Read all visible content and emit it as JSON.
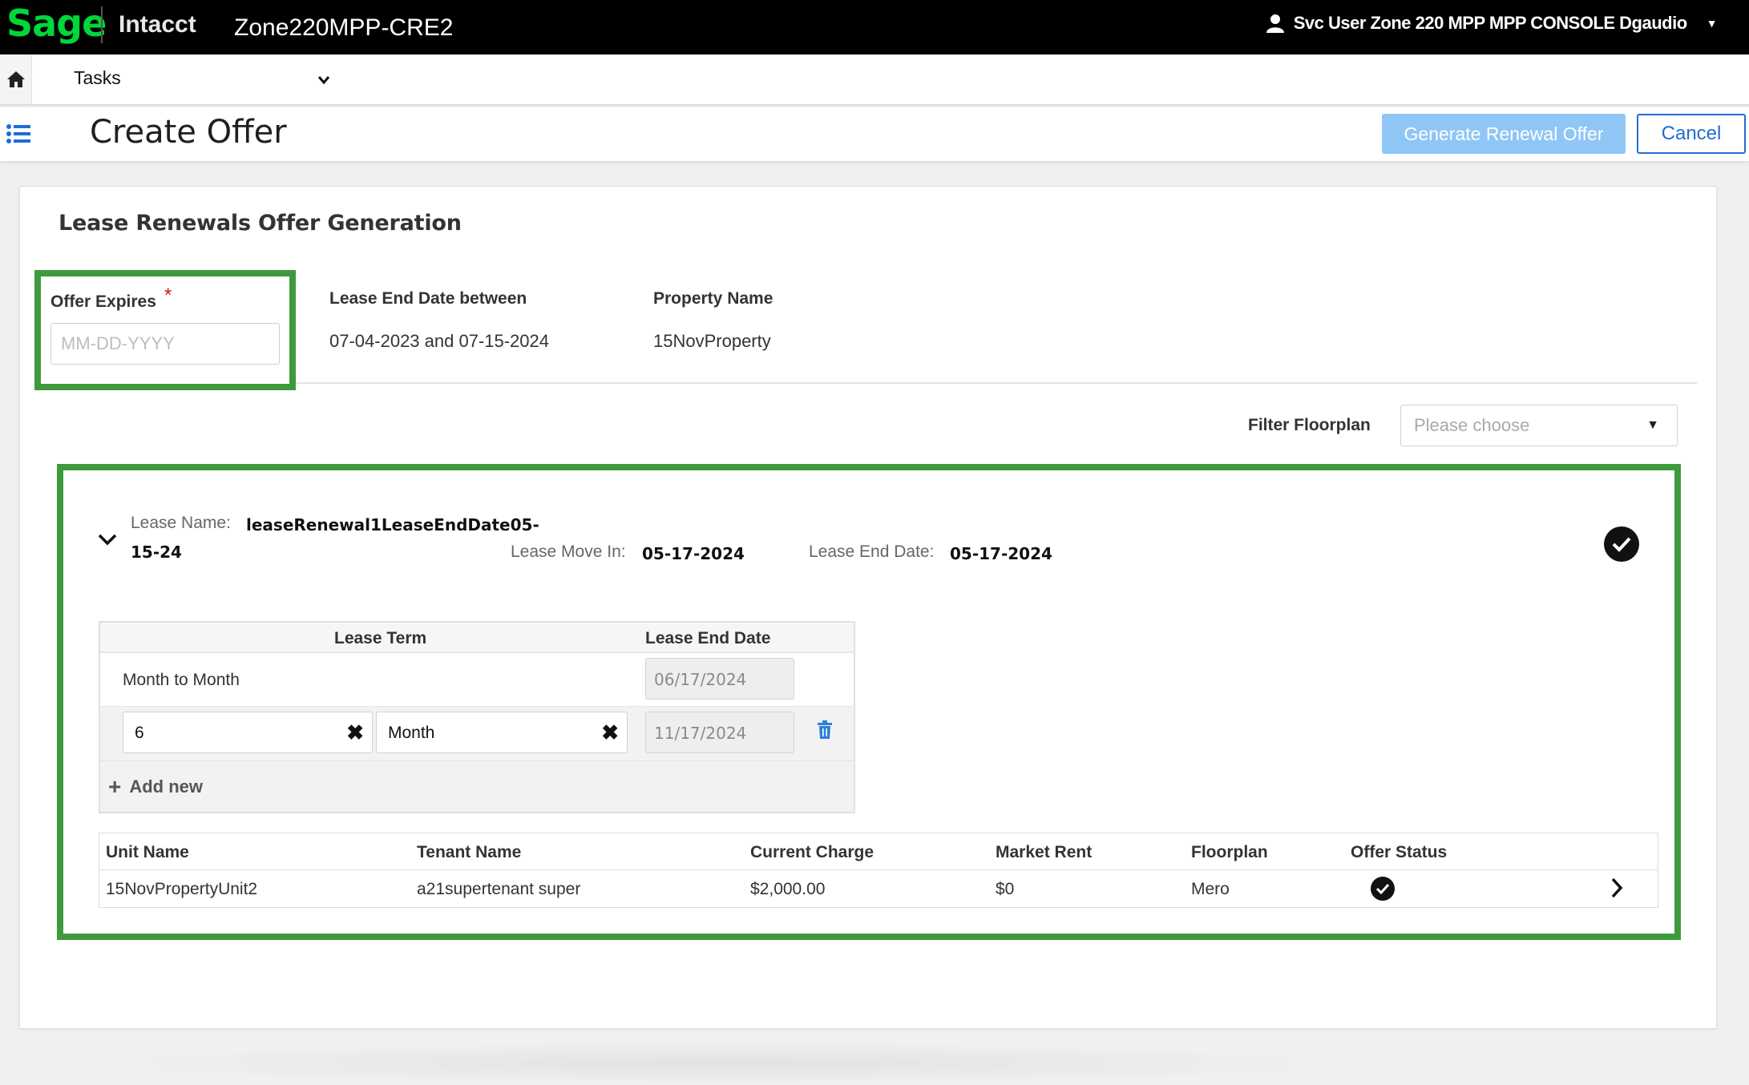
{
  "header": {
    "logo": "Sage",
    "product": "Intacct",
    "company": "Zone220MPP-CRE2",
    "user": "Svc User Zone 220 MPP MPP CONSOLE Dgaudio"
  },
  "nav": {
    "menu": "Tasks"
  },
  "page": {
    "title": "Create Offer",
    "generate_label": "Generate Renewal Offer",
    "cancel_label": "Cancel"
  },
  "form": {
    "section_title": "Lease Renewals Offer Generation",
    "offer_expires_label": "Offer Expires",
    "required_mark": "*",
    "offer_expires_placeholder": "MM-DD-YYYY",
    "offer_expires_value": "",
    "lease_end_label": "Lease End Date between",
    "lease_end_value": "07-04-2023 and 07-15-2024",
    "property_label": "Property Name",
    "property_value": "15NovProperty",
    "filter_label": "Filter Floorplan",
    "filter_placeholder": "Please choose"
  },
  "lease": {
    "name_label": "Lease Name:",
    "name_value_line1": "leaseRenewal1LeaseEndDate05-",
    "name_value_line2": "15-24",
    "move_in_label": "Lease Move In:",
    "move_in_value": "05-17-2024",
    "end_label": "Lease End Date:",
    "end_value": "05-17-2024",
    "term_headers": [
      "Lease Term",
      "Lease End Date"
    ],
    "term_rows": [
      {
        "term": "Month to Month",
        "end_date": "06/17/2024"
      },
      {
        "term_count": "6",
        "term_unit": "Month",
        "end_date": "11/17/2024"
      }
    ],
    "add_new_label": "Add new",
    "unit_headers": [
      "Unit Name",
      "Tenant Name",
      "Current Charge",
      "Market Rent",
      "Floorplan",
      "Offer Status"
    ],
    "unit_rows": [
      {
        "unit": "15NovPropertyUnit2",
        "tenant": "a21supertenant super",
        "current_charge": "$2,000.00",
        "market_rent": "$0",
        "floorplan": "Mero",
        "status_icon": "check-circle-icon"
      }
    ]
  },
  "colors": {
    "brand_green": "#00d639",
    "highlight_green": "#3d9a3d",
    "primary_blue": "#1f6dd6",
    "disabled_blue": "#8fc6f6"
  }
}
